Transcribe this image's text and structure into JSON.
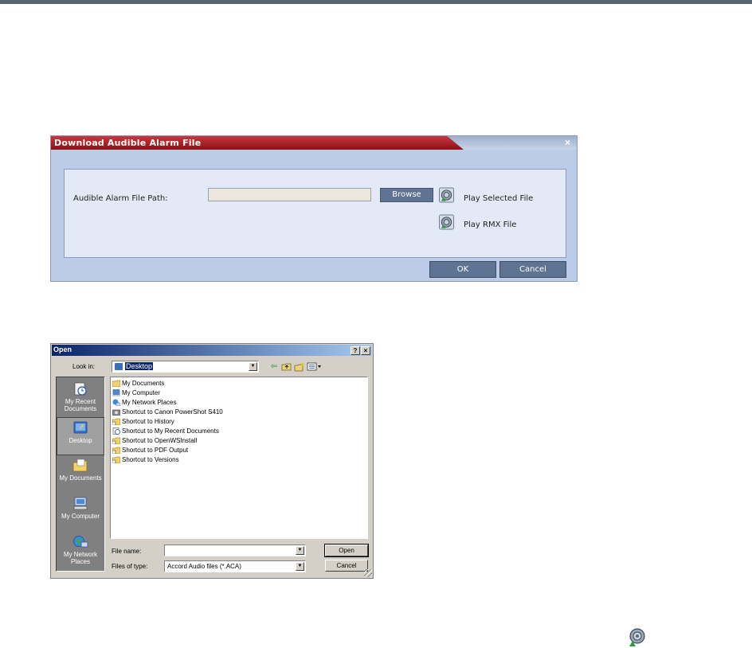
{
  "alarm_dialog": {
    "title": "Download Audible Alarm File",
    "close_glyph": "×",
    "file_path_label": "Audible Alarm File Path:",
    "file_path_value": "",
    "browse_label": "Browse",
    "play_selected_label": "Play Selected File",
    "play_rmx_label": "Play RMX File",
    "ok_label": "OK",
    "cancel_label": "Cancel",
    "icon": "speaker-icon"
  },
  "open_dialog": {
    "title": "Open",
    "help_glyph": "?",
    "close_glyph": "×",
    "look_in_label": "Look in:",
    "look_in_value": "Desktop",
    "toolbar_icons": [
      "back-arrow-icon",
      "up-folder-icon",
      "new-folder-icon",
      "view-menu-icon"
    ],
    "places": [
      {
        "label": "My Recent Documents",
        "icon": "recent-documents-icon"
      },
      {
        "label": "Desktop",
        "icon": "desktop-icon"
      },
      {
        "label": "My Documents",
        "icon": "my-documents-icon"
      },
      {
        "label": "My Computer",
        "icon": "my-computer-icon"
      },
      {
        "label": "My Network Places",
        "icon": "network-places-icon"
      }
    ],
    "files": [
      {
        "name": "My Documents",
        "icon": "my-documents-icon"
      },
      {
        "name": "My Computer",
        "icon": "my-computer-icon"
      },
      {
        "name": "My Network Places",
        "icon": "network-places-icon"
      },
      {
        "name": "Shortcut to Canon PowerShot S410",
        "icon": "camera-shortcut-icon"
      },
      {
        "name": "Shortcut to History",
        "icon": "folder-shortcut-icon"
      },
      {
        "name": "Shortcut to My Recent Documents",
        "icon": "recent-shortcut-icon"
      },
      {
        "name": "Shortcut to OpenWSInstall",
        "icon": "folder-shortcut-icon"
      },
      {
        "name": "Shortcut to PDF Output",
        "icon": "folder-shortcut-icon"
      },
      {
        "name": "Shortcut to Versions",
        "icon": "folder-shortcut-icon"
      }
    ],
    "file_name_label": "File name:",
    "file_name_value": "",
    "files_of_type_label": "Files of type:",
    "files_of_type_value": "Accord Audio files (*.ACA)",
    "open_button": "Open",
    "cancel_button": "Cancel"
  },
  "colors": {
    "title_red": "#b42127",
    "dialog_blue": "#bccbe8",
    "button_blue": "#5f7392",
    "win_face": "#d4d0c8",
    "win_title": "#0a246a"
  }
}
